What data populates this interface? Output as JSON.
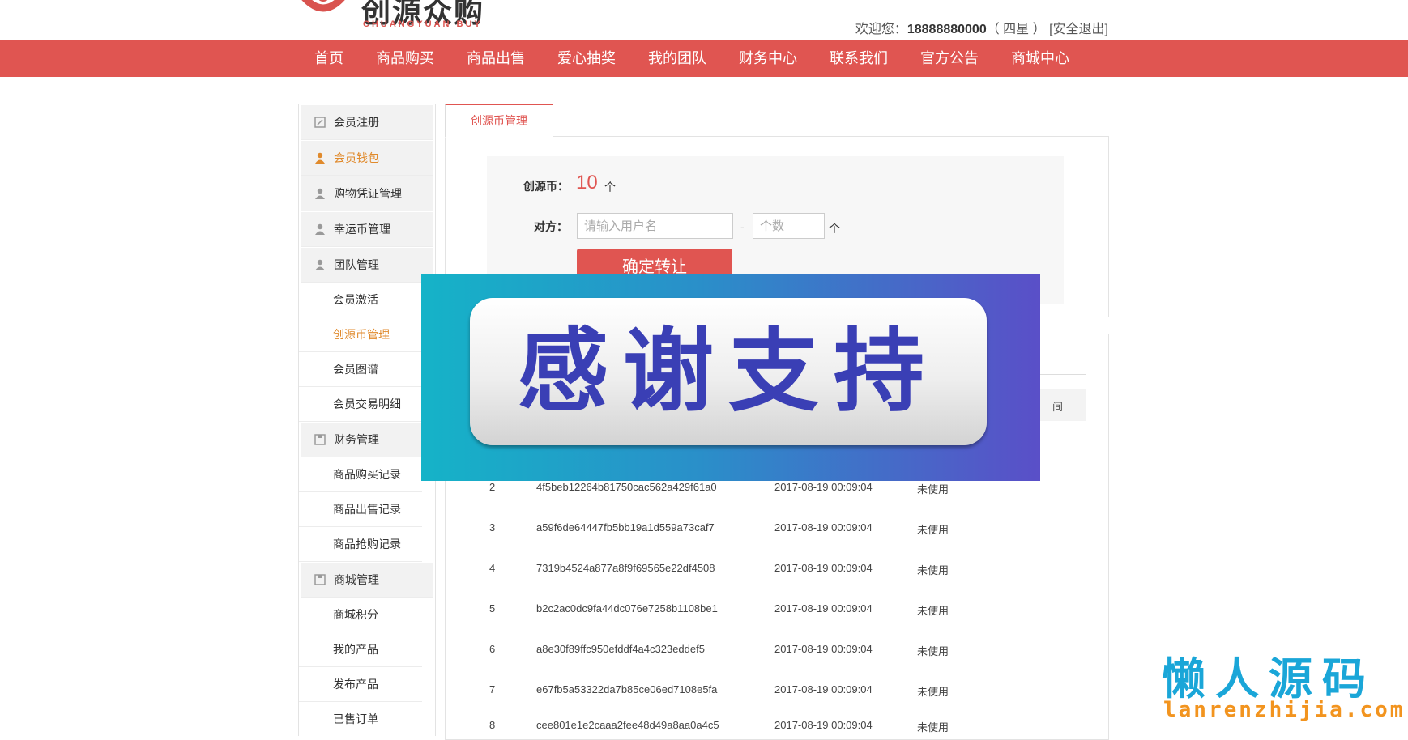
{
  "header": {
    "logo_cn": "创源众购",
    "logo_en": "CHUANGYUAN BUY",
    "welcome_prefix": "欢迎您：",
    "user_phone": "18888880000",
    "user_level": "（ 四星 ）",
    "logout": "[安全退出]"
  },
  "nav": [
    "首页",
    "商品购买",
    "商品出售",
    "爱心抽奖",
    "我的团队",
    "财务中心",
    "联系我们",
    "官方公告",
    "商城中心"
  ],
  "sidebar": {
    "groups": [
      {
        "label": "会员注册",
        "icon": "edit-icon"
      },
      {
        "label": "会员钱包",
        "icon": "user-icon"
      },
      {
        "label": "购物凭证管理",
        "icon": "user-icon"
      },
      {
        "label": "幸运币管理",
        "icon": "user-icon"
      },
      {
        "label": "团队管理",
        "icon": "user-icon"
      },
      {
        "label": "财务管理",
        "icon": "save-icon"
      },
      {
        "label": "商城管理",
        "icon": "save-icon"
      }
    ],
    "subs": [
      "会员激活",
      "创源币管理",
      "会员图谱",
      "会员交易明细",
      "商品购买记录",
      "商品出售记录",
      "商品抢购记录",
      "商城积分",
      "我的产品",
      "发布产品",
      "已售订单"
    ]
  },
  "tab_label": "创源币管理",
  "form": {
    "coin_label": "创源币：",
    "coin_value": "10",
    "coin_unit": "个",
    "target_label": "对方：",
    "username_placeholder": "请输入用户名",
    "dash": "-",
    "count_placeholder": "个数",
    "count_unit": "个",
    "submit": "确定转让"
  },
  "table": {
    "header_time_partial": "间",
    "rows": [
      {
        "no": "2",
        "code": "4f5beb12264b81750cac562a429f61a0",
        "time": "2017-08-19 00:09:04",
        "status": "未使用"
      },
      {
        "no": "3",
        "code": "a59f6de64447fb5bb19a1d559a73caf7",
        "time": "2017-08-19 00:09:04",
        "status": "未使用"
      },
      {
        "no": "4",
        "code": "7319b4524a877a8f9f69565e22df4508",
        "time": "2017-08-19 00:09:04",
        "status": "未使用"
      },
      {
        "no": "5",
        "code": "b2c2ac0dc9fa44dc076e7258b1108be1",
        "time": "2017-08-19 00:09:04",
        "status": "未使用"
      },
      {
        "no": "6",
        "code": "a8e30f89ffc950efddf4a4c323eddef5",
        "time": "2017-08-19 00:09:04",
        "status": "未使用"
      },
      {
        "no": "7",
        "code": "e67fb5a53322da7b85ce06ed7108e5fa",
        "time": "2017-08-19 00:09:04",
        "status": "未使用"
      },
      {
        "no": "8",
        "code": "cee801e1e2caaa2fee48d49a8aa0a4c5",
        "time": "2017-08-19 00:09:04",
        "status": "未使用"
      }
    ]
  },
  "overlay_text": "感谢支持",
  "watermark": {
    "cn": "懒人源码",
    "en": "lanrenzhijia.com"
  },
  "colors": {
    "brand_red": "#e05551",
    "active_orange": "#e08a2c",
    "overlay_text": "#3a3fb5",
    "watermark_blue": "#1aa6d8",
    "watermark_orange": "#f2941f"
  }
}
